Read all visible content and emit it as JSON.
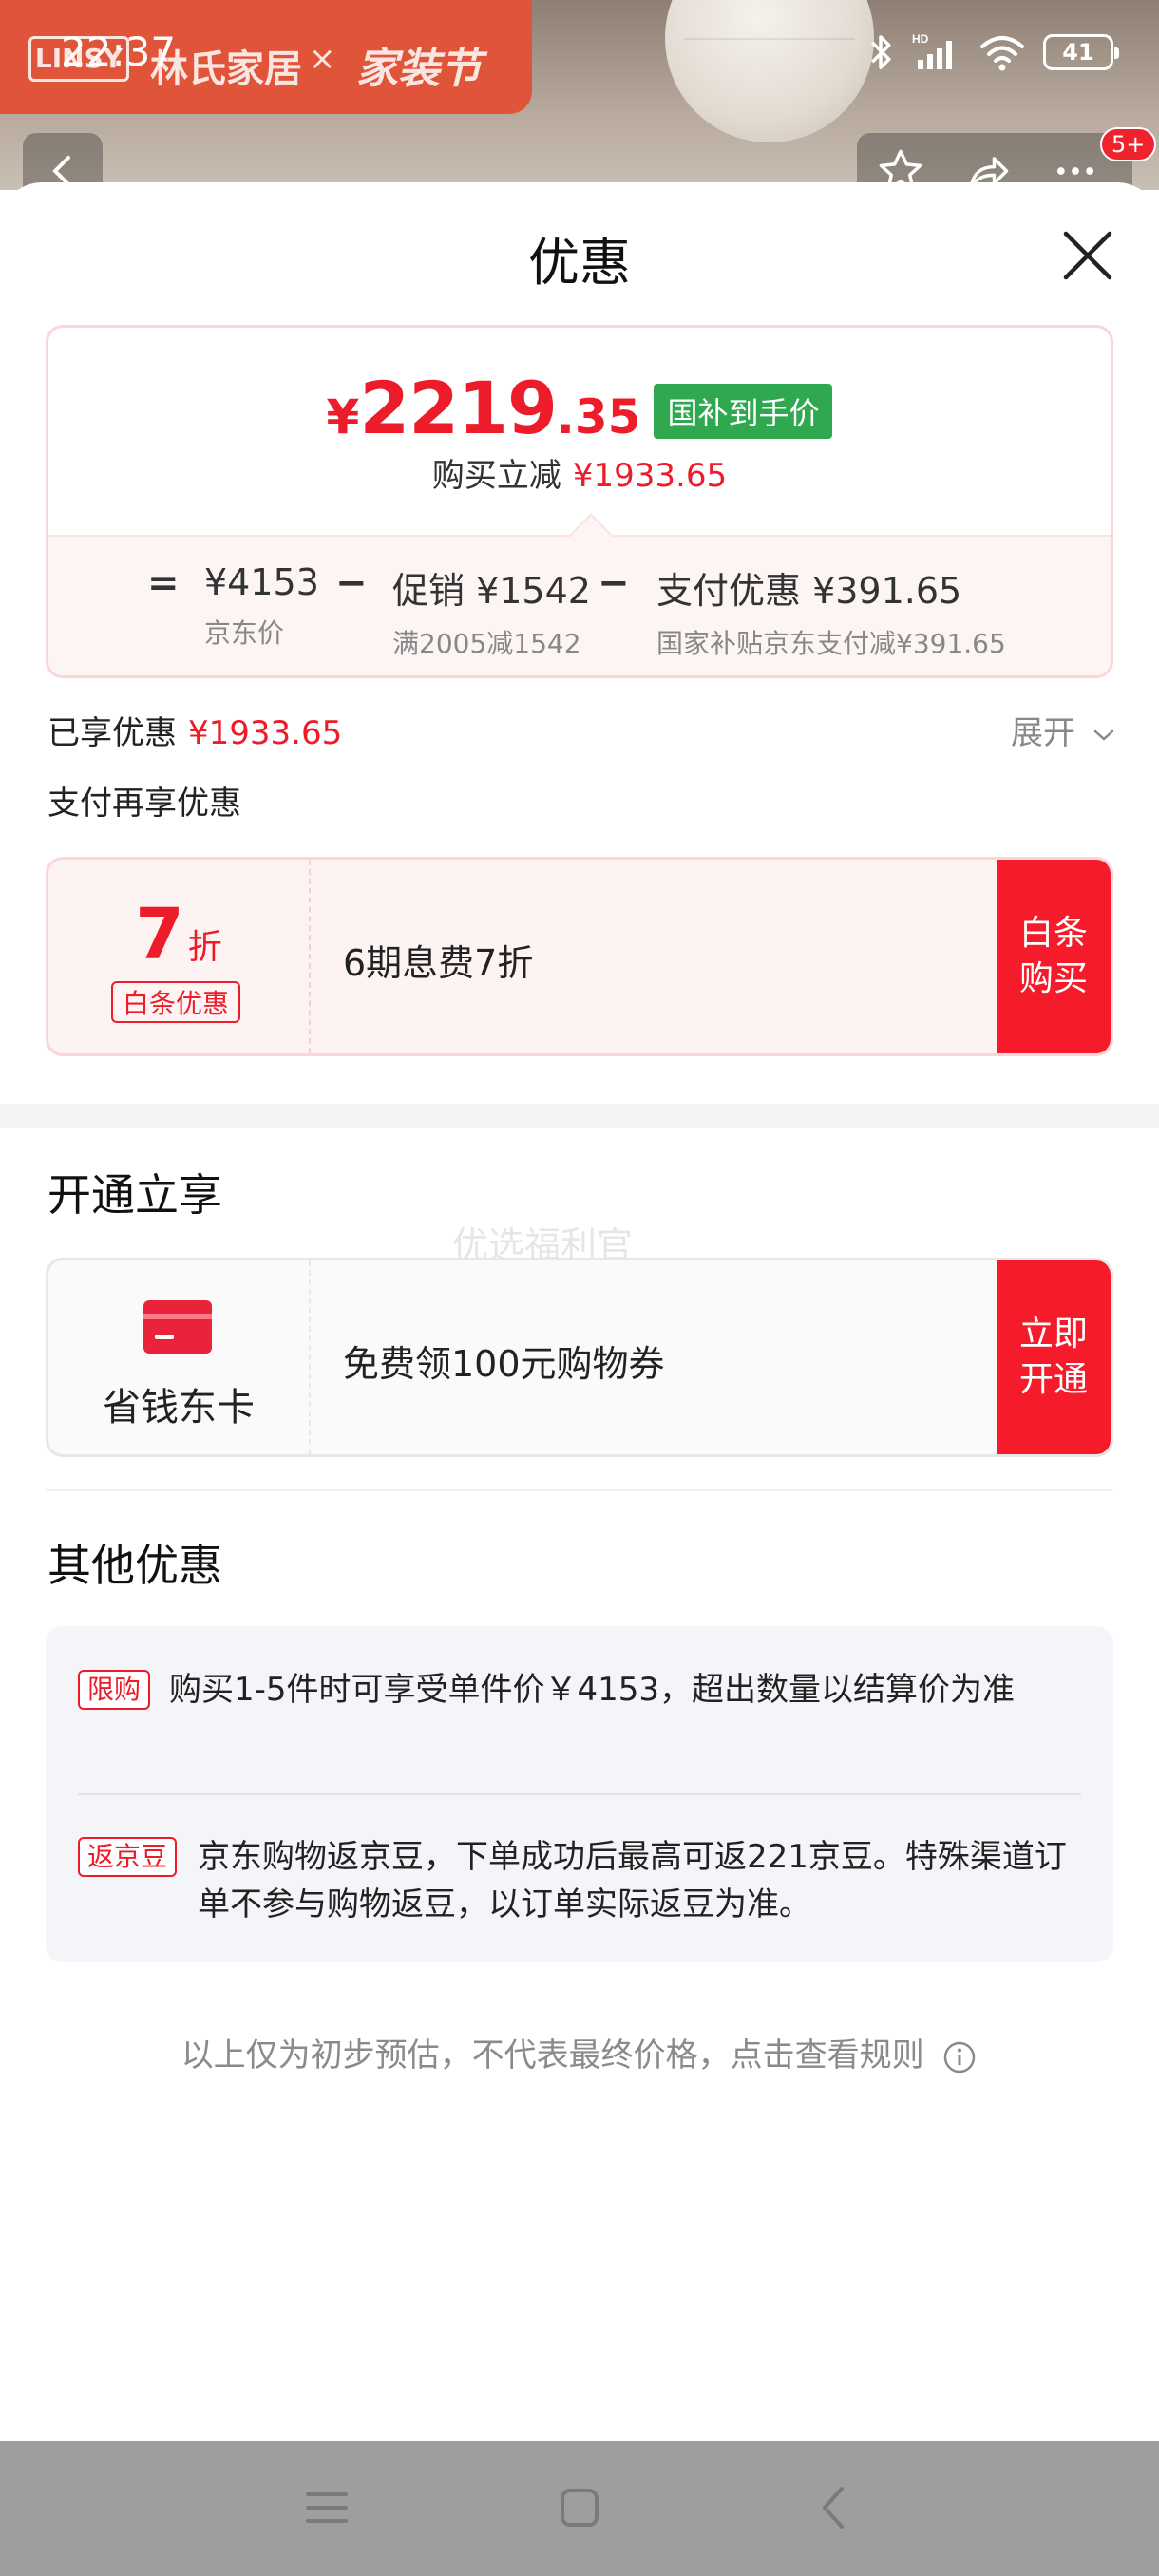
{
  "status_bar": {
    "time": "22:37",
    "battery": "41"
  },
  "background": {
    "banner_logo": "LINSY",
    "banner_brand": "林氏家居",
    "banner_x": "×",
    "banner_festival": "家装节",
    "badge": "5+"
  },
  "sheet": {
    "title": "优惠",
    "price": {
      "currency": "¥",
      "integer": "2219",
      "decimal": ".35",
      "tag": "国补到手价",
      "save_label": "购买立减",
      "save_amount": "¥1933.65"
    },
    "formula": {
      "eq": "=",
      "minus1": "−",
      "minus2": "−",
      "items": [
        {
          "main": "¥4153",
          "sub": "京东价"
        },
        {
          "main": "促销 ¥1542",
          "sub": "满2005减1542"
        },
        {
          "main": "支付优惠 ¥391.65",
          "sub": "国家补贴京东支付减¥391.65"
        }
      ]
    },
    "enjoyed_label": "已享优惠",
    "enjoyed_amount": "¥1933.65",
    "expand_label": "展开",
    "pay_more_label": "支付再享优惠",
    "baitiao": {
      "discount_num": "7",
      "discount_unit": "折",
      "tag": "白条优惠",
      "text": "6期息费7折",
      "button": "白条\n购买"
    },
    "open_section": {
      "title": "开通立享",
      "watermark": "优选福利官",
      "card_name": "省钱东卡",
      "text": "免费领100元购物券",
      "button": "立即\n开通"
    },
    "other_section": {
      "title": "其他优惠",
      "items": [
        {
          "tag": "限购",
          "text": "购买1-5件时可享受单件价￥4153，超出数量以结算价为准"
        },
        {
          "tag": "返京豆",
          "text": "京东购物返京豆，下单成功后最高可返221京豆。特殊渠道订单不参与购物返豆，以订单实际返豆为准。"
        }
      ]
    },
    "footnote": "以上仅为初步预估，不代表最终价格，点击查看规则"
  },
  "colors": {
    "accent_red": "#ec1c2a",
    "tag_green": "#2fa84f"
  }
}
